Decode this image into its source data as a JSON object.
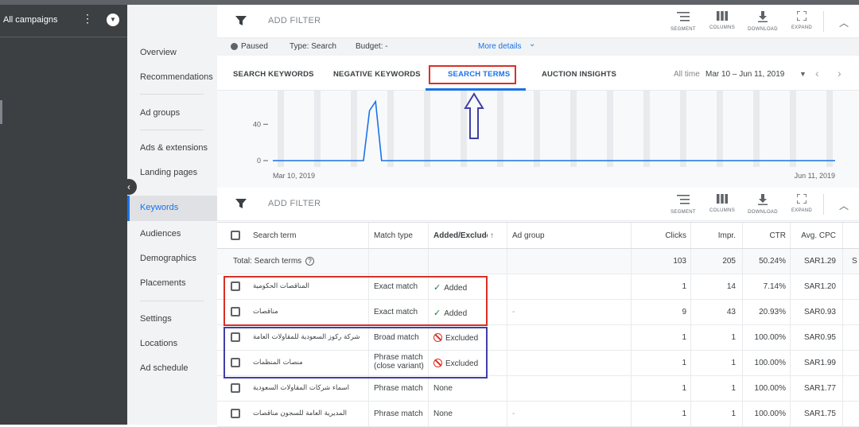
{
  "sidebar": {
    "campaign_title": "All campaigns",
    "menu_glyph": "⋮",
    "dropdown_glyph": "▼"
  },
  "nav": {
    "items": [
      "Overview",
      "Recommendations",
      "Ad groups",
      "Ads & extensions",
      "Landing pages",
      "Keywords",
      "Audiences",
      "Demographics",
      "Placements",
      "Settings",
      "Locations",
      "Ad schedule"
    ],
    "active": "Keywords",
    "collapse_glyph": "‹"
  },
  "toolbar": {
    "filter_label": "ADD FILTER",
    "segment": "SEGMENT",
    "columns": "COLUMNS",
    "download": "DOWNLOAD",
    "expand": "EXPAND",
    "collapse_glyph": "︿"
  },
  "status": {
    "paused": "Paused",
    "type": "Type: Search",
    "budget": "Budget: -",
    "more_details": "More details",
    "more_glyph": "⌄"
  },
  "tabs": {
    "items": [
      "SEARCH KEYWORDS",
      "NEGATIVE KEYWORDS",
      "SEARCH TERMS",
      "AUCTION INSIGHTS"
    ],
    "active": "SEARCH TERMS"
  },
  "date": {
    "all_time": "All time",
    "range": "Mar 10 – Jun 11, 2019",
    "caret": "▼",
    "prev": "‹",
    "next": "›"
  },
  "chart_data": {
    "type": "line",
    "x_labels": [
      "Mar 10, 2019",
      "Jun 11, 2019"
    ],
    "y_ticks": [
      0,
      40
    ],
    "ylim": [
      0,
      70
    ],
    "series": [
      {
        "values": [
          0,
          0,
          0,
          0,
          0,
          0,
          0,
          0,
          0,
          0,
          0,
          0,
          0,
          0,
          0,
          0,
          55,
          65,
          0,
          0,
          0,
          0,
          0,
          0,
          0,
          0,
          0,
          0,
          0,
          0,
          0,
          0,
          0,
          0,
          0,
          0,
          0,
          0,
          0,
          0,
          0,
          0,
          0,
          0,
          0,
          0,
          0,
          0,
          0,
          0,
          0,
          0,
          0,
          0,
          0,
          0,
          0,
          0,
          0,
          0,
          0,
          0,
          0,
          0,
          0,
          0,
          0,
          0,
          0,
          0,
          0,
          0,
          0,
          0,
          0,
          0,
          0,
          0,
          0,
          0,
          0,
          0,
          0,
          0,
          0,
          0,
          0,
          0,
          0,
          0,
          0,
          0,
          0,
          0
        ],
        "color": "#1a73e8"
      }
    ],
    "grid": true
  },
  "table": {
    "columns": [
      "Search term",
      "Match type",
      "Added/Excluded",
      "Ad group",
      "Clicks",
      "Impr.",
      "CTR",
      "Avg. CPC"
    ],
    "sort_glyph": "↑",
    "total": {
      "label": "Total: Search terms",
      "help_glyph": "?",
      "clicks": "103",
      "impr": "205",
      "ctr": "50.24%",
      "cpc": "SAR1.29",
      "overflow": "S"
    },
    "rows": [
      {
        "term": "المناقصات الحكومية",
        "match": "Exact match",
        "match2": "",
        "status": "Added",
        "adgroup": "",
        "clicks": "1",
        "impr": "14",
        "ctr": "7.14%",
        "cpc": "SAR1.20"
      },
      {
        "term": "مناقصات",
        "match": "Exact match",
        "match2": "",
        "status": "Added",
        "adgroup": "-",
        "clicks": "9",
        "impr": "43",
        "ctr": "20.93%",
        "cpc": "SAR0.93"
      },
      {
        "term": "شركة ركوز السعودية للمقاولات العامة",
        "match": "Broad match",
        "match2": "",
        "status": "Excluded",
        "adgroup": "",
        "clicks": "1",
        "impr": "1",
        "ctr": "100.00%",
        "cpc": "SAR0.95"
      },
      {
        "term": "منصات المنظمات",
        "match": "Phrase match",
        "match2": "(close variant)",
        "status": "Excluded",
        "adgroup": "",
        "clicks": "1",
        "impr": "1",
        "ctr": "100.00%",
        "cpc": "SAR1.99"
      },
      {
        "term": "اسماء شركات المقاولات السعودية",
        "match": "Phrase match",
        "match2": "",
        "status": "None",
        "adgroup": "",
        "clicks": "1",
        "impr": "1",
        "ctr": "100.00%",
        "cpc": "SAR1.77"
      },
      {
        "term": "المديرية العامة للسجون مناقصات",
        "match": "Phrase match",
        "match2": "",
        "status": "None",
        "adgroup": "-",
        "clicks": "1",
        "impr": "1",
        "ctr": "100.00%",
        "cpc": "SAR1.75"
      }
    ]
  },
  "colors": {
    "accent": "#1a73e8",
    "annotation_red": "#d93025",
    "annotation_blue": "#3f3fa8"
  }
}
